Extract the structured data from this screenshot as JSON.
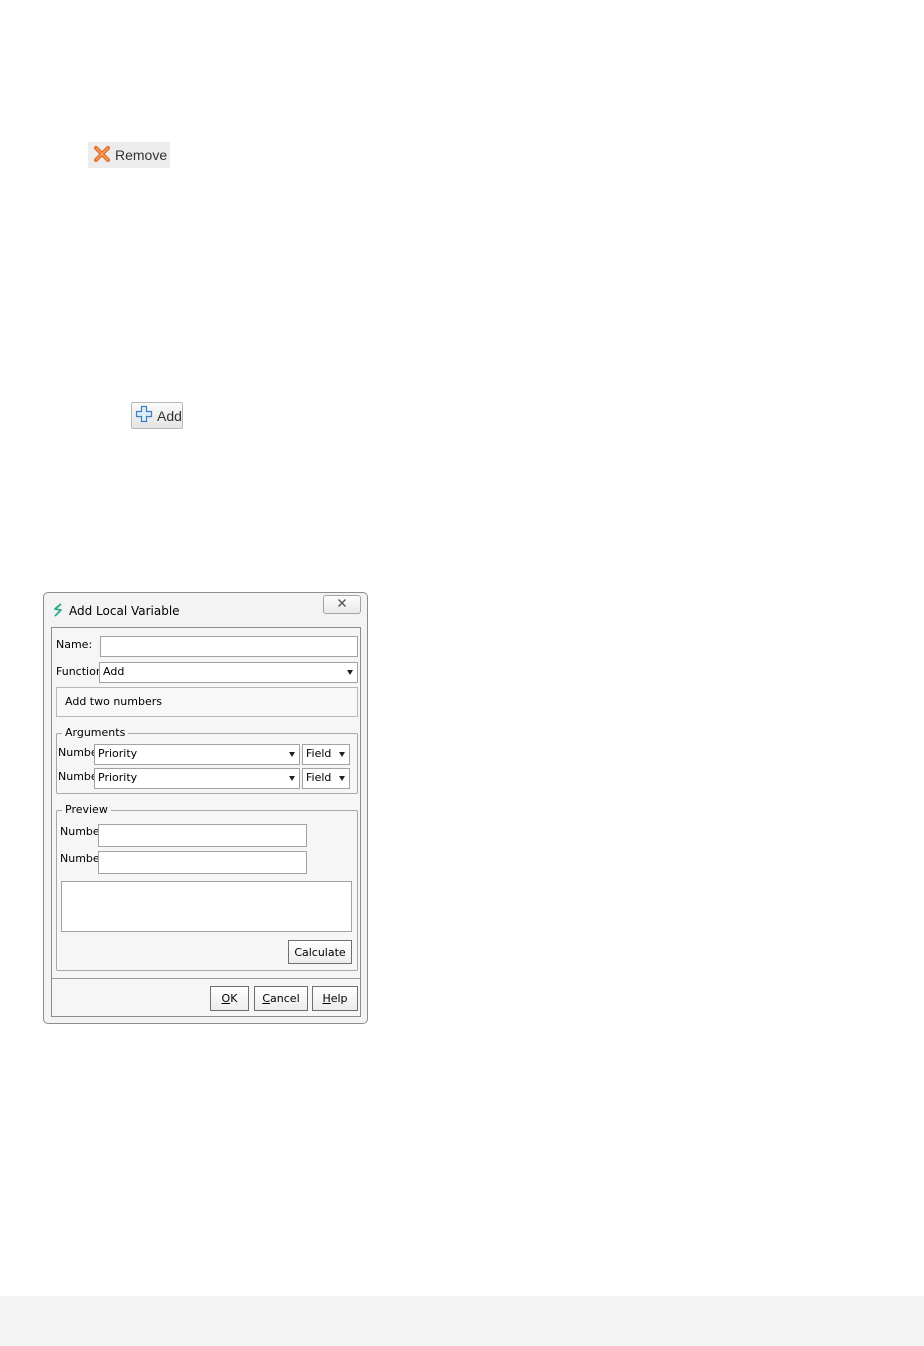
{
  "toolbar": {
    "remove_label": "Remove",
    "add_label": "Add"
  },
  "dialog": {
    "title": "Add Local Variable",
    "name_label": "Name:",
    "name_value": "",
    "function_label": "Function:",
    "function_value": "Add",
    "description": "Add two numbers",
    "arguments": {
      "title": "Arguments",
      "rows": [
        {
          "label": "Number",
          "value": "Priority",
          "type": "Field"
        },
        {
          "label": "Number",
          "value": "Priority",
          "type": "Field"
        }
      ]
    },
    "preview": {
      "title": "Preview",
      "rows": [
        {
          "label": "Number",
          "value": ""
        },
        {
          "label": "Number",
          "value": ""
        }
      ],
      "result": "",
      "calculate_label": "Calculate"
    },
    "buttons": {
      "ok_mnemonic": "O",
      "ok_rest": "K",
      "cancel_mnemonic": "C",
      "cancel_rest": "ancel",
      "help_mnemonic": "H",
      "help_rest": "elp"
    }
  },
  "colors": {
    "remove_icon": "#e2641e",
    "add_icon": "#3b7fc4",
    "app_icon": "#2aa88a"
  }
}
